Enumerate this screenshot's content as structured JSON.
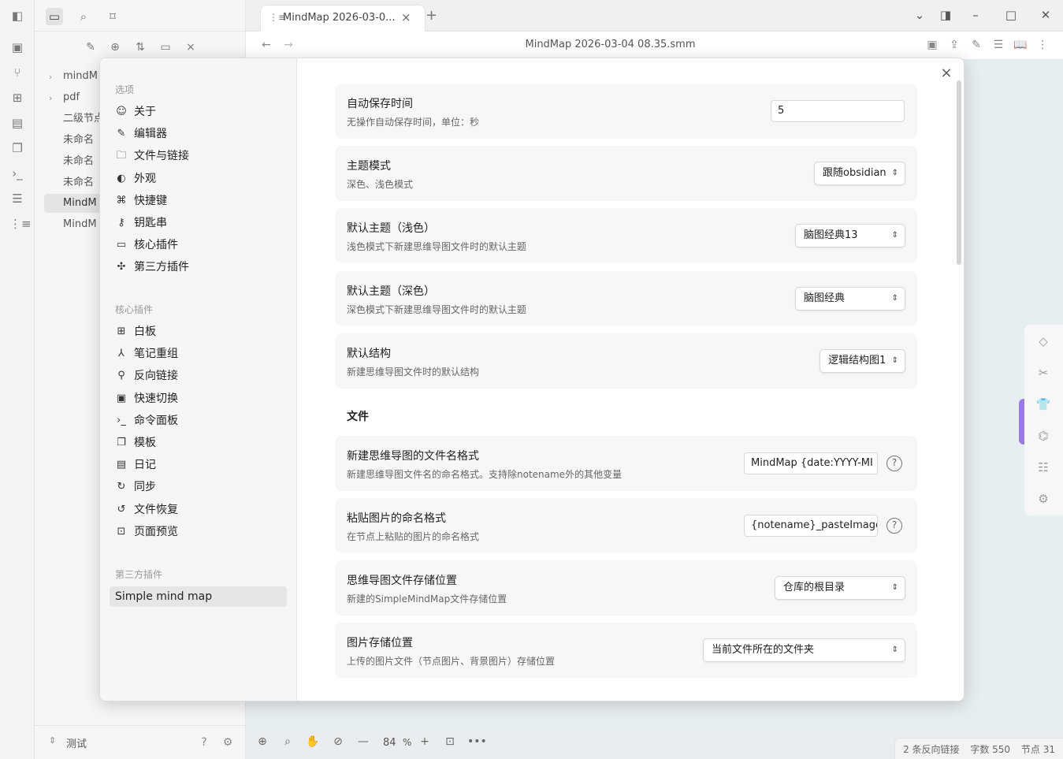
{
  "app": {
    "tab_title": "MindMap 2026-03-0...",
    "view_title": "MindMap 2026-03-04 08.35.smm",
    "new_tab_glyph": "+",
    "close_glyph": "×"
  },
  "sidebar": {
    "tree": [
      {
        "label": "mindM",
        "folder": true
      },
      {
        "label": "pdf",
        "folder": true
      },
      {
        "label": "二级节点",
        "folder": false
      },
      {
        "label": "未命名",
        "folder": false
      },
      {
        "label": "未命名",
        "folder": false
      },
      {
        "label": "未命名",
        "folder": false
      },
      {
        "label": "MindM",
        "folder": false,
        "selected": true
      },
      {
        "label": "MindM",
        "folder": false
      }
    ],
    "vault_name": "测试"
  },
  "bottom_toolbar": {
    "zoom": "84",
    "zoom_unit": "%"
  },
  "status": {
    "backlinks": "2 条反向链接",
    "words": "字数 550",
    "nodes": "节点 31"
  },
  "settings_modal": {
    "nav_heading_options": "选项",
    "nav_options": [
      {
        "label": "关于",
        "icon": "user-circle-icon"
      },
      {
        "label": "编辑器",
        "icon": "pencil-icon"
      },
      {
        "label": "文件与链接",
        "icon": "folder-link-icon"
      },
      {
        "label": "外观",
        "icon": "palette-icon"
      },
      {
        "label": "快捷键",
        "icon": "command-icon"
      },
      {
        "label": "钥匙串",
        "icon": "key-icon"
      },
      {
        "label": "核心插件",
        "icon": "calendar-plugin-icon"
      },
      {
        "label": "第三方插件",
        "icon": "puzzle-icon"
      }
    ],
    "nav_heading_core": "核心插件",
    "nav_core": [
      {
        "label": "白板",
        "icon": "canvas-icon"
      },
      {
        "label": "笔记重组",
        "icon": "merge-icon"
      },
      {
        "label": "反向链接",
        "icon": "backlink-icon"
      },
      {
        "label": "快速切换",
        "icon": "switch-icon"
      },
      {
        "label": "命令面板",
        "icon": "terminal-icon"
      },
      {
        "label": "模板",
        "icon": "template-icon"
      },
      {
        "label": "日记",
        "icon": "calendar-icon"
      },
      {
        "label": "同步",
        "icon": "sync-icon"
      },
      {
        "label": "文件恢复",
        "icon": "history-icon"
      },
      {
        "label": "页面预览",
        "icon": "preview-icon"
      }
    ],
    "nav_heading_community": "第三方插件",
    "nav_community_active": "Simple mind map",
    "settings": [
      {
        "name": "自动保存时间",
        "desc": "无操作自动保存时间，单位：秒",
        "control": "input",
        "value": "5"
      },
      {
        "name": "主题模式",
        "desc": "深色、浅色模式",
        "control": "select",
        "value": "跟随obsidian"
      },
      {
        "name": "默认主题（浅色）",
        "desc": "浅色模式下新建思维导图文件时的默认主题",
        "control": "select",
        "value": "脑图经典13"
      },
      {
        "name": "默认主题（深色）",
        "desc": "深色模式下新建思维导图文件时的默认主题",
        "control": "select",
        "value": "脑图经典"
      },
      {
        "name": "默认结构",
        "desc": "新建思维导图文件时的默认结构",
        "control": "select",
        "value": "逻辑结构图1"
      }
    ],
    "section_file": "文件",
    "file_settings": [
      {
        "name": "新建思维导图的文件名格式",
        "desc": "新建思维导图文件名的命名格式。支持除notename外的其他变量",
        "control": "input",
        "value": "MindMap {date:YYYY-MI",
        "help": "?"
      },
      {
        "name": "粘贴图片的命名格式",
        "desc": "在节点上粘贴的图片的命名格式",
        "control": "input",
        "value": "{notename}_pasteImage",
        "help": "?"
      },
      {
        "name": "思维导图文件存储位置",
        "desc": "新建的SimpleMindMap文件存储位置",
        "control": "select",
        "value": "仓库的根目录"
      },
      {
        "name": "图片存储位置",
        "desc": "上传的图片文件（节点图片、背景图片）存储位置",
        "control": "select",
        "value": "当前文件所在的文件夹"
      }
    ]
  }
}
